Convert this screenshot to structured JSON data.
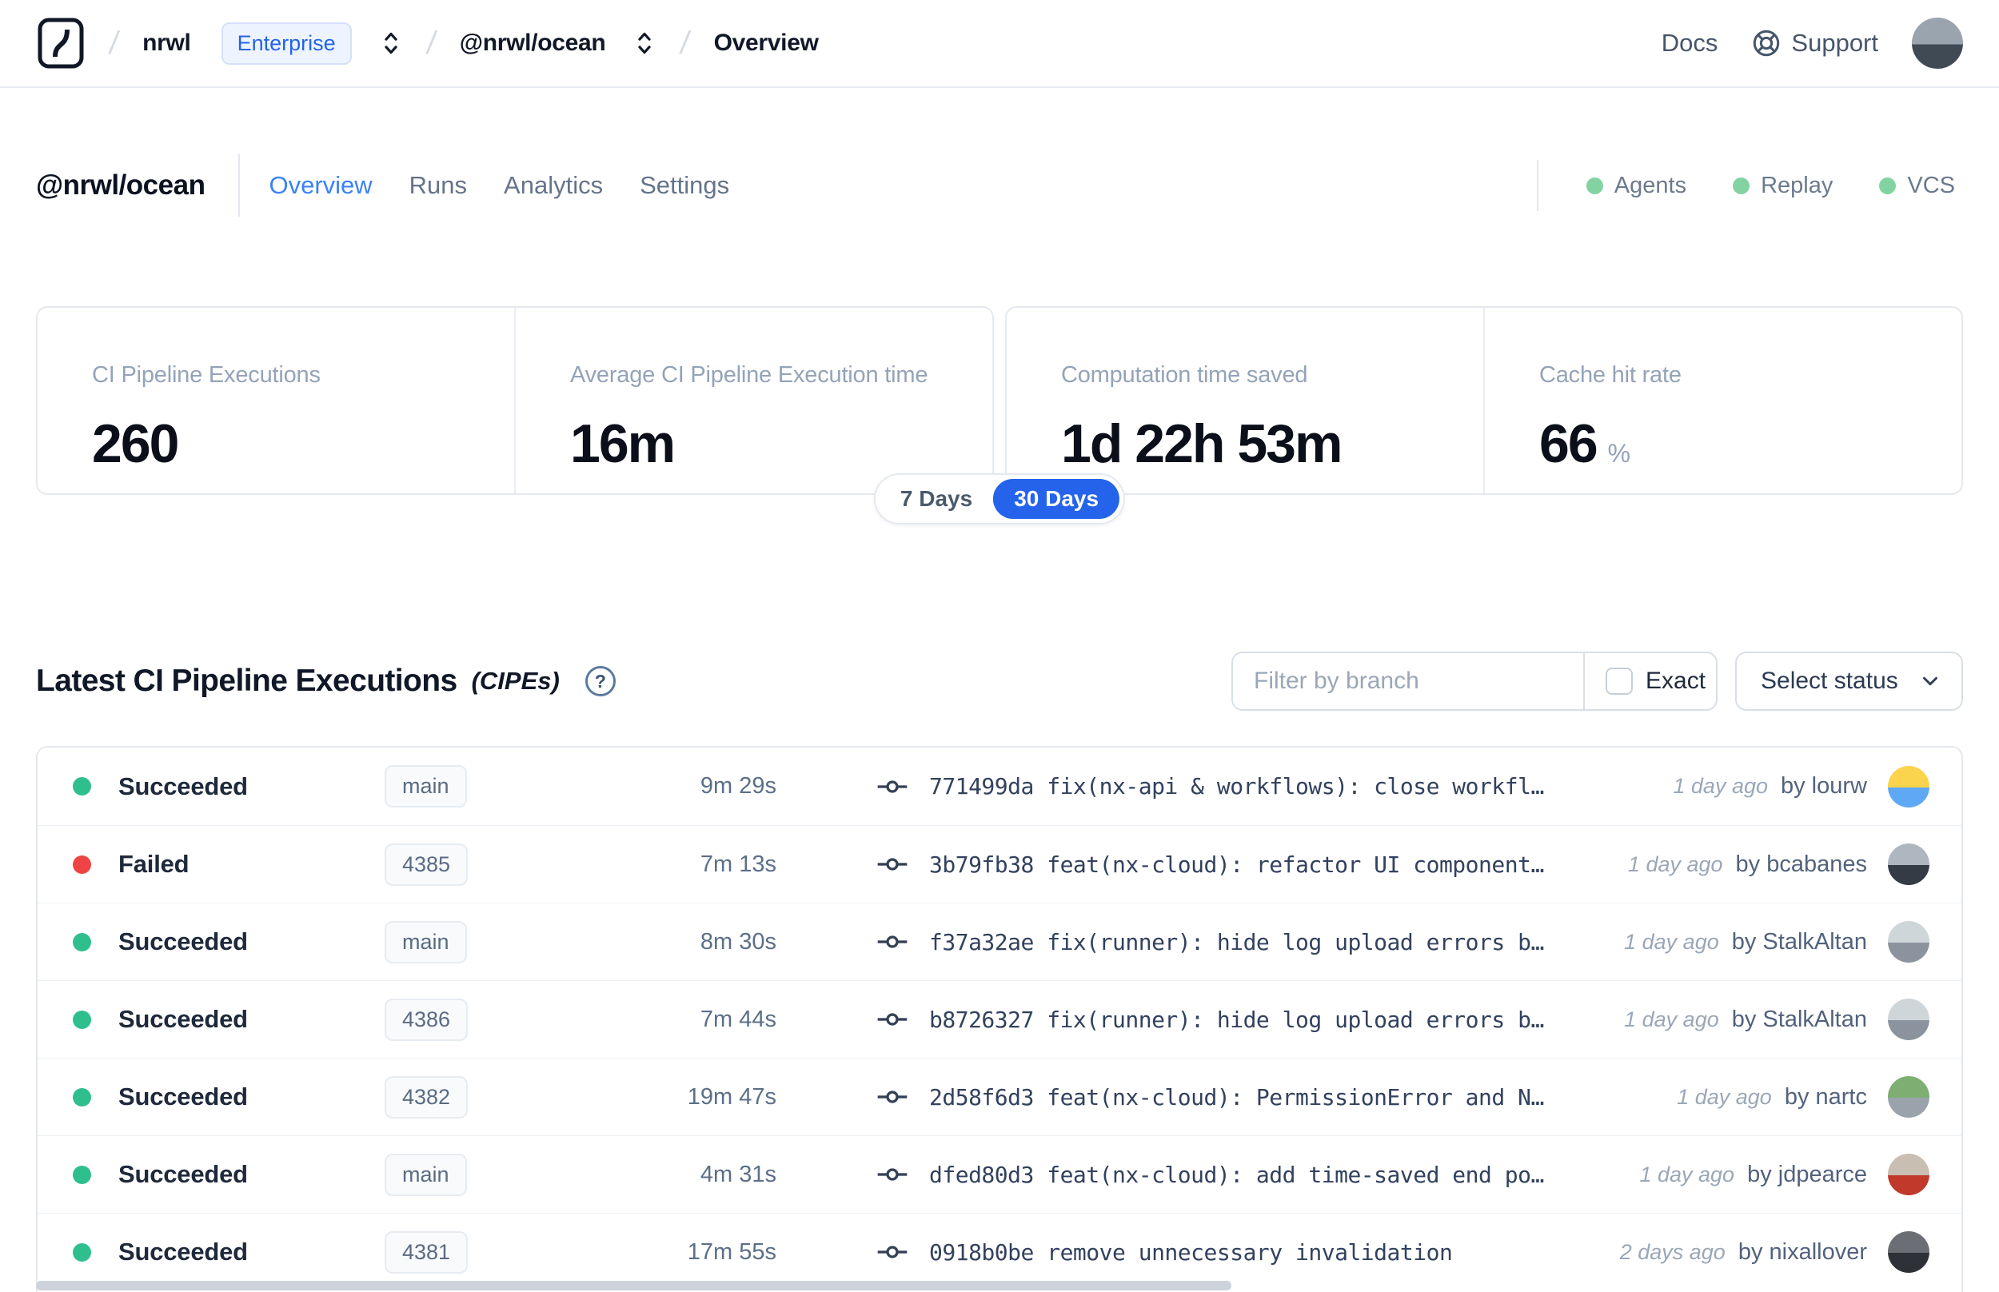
{
  "header": {
    "breadcrumb": {
      "org": "nrwl",
      "org_badge": "Enterprise",
      "workspace": "@nrwl/ocean",
      "page": "Overview"
    },
    "nav": {
      "docs": "Docs",
      "support": "Support"
    }
  },
  "workspace": {
    "title": "@nrwl/ocean",
    "tabs": [
      {
        "label": "Overview",
        "active": true
      },
      {
        "label": "Runs",
        "active": false
      },
      {
        "label": "Analytics",
        "active": false
      },
      {
        "label": "Settings",
        "active": false
      }
    ],
    "services": [
      {
        "label": "Agents"
      },
      {
        "label": "Replay"
      },
      {
        "label": "VCS"
      }
    ]
  },
  "stats": {
    "cards": [
      {
        "label": "CI Pipeline Executions",
        "value": "260",
        "suffix": ""
      },
      {
        "label": "Average CI Pipeline Execution time",
        "value": "16m",
        "suffix": ""
      },
      {
        "label": "Computation time saved",
        "value": "1d 22h 53m",
        "suffix": ""
      },
      {
        "label": "Cache hit rate",
        "value": "66",
        "suffix": "%"
      }
    ],
    "range_toggle": {
      "options": [
        "7 Days",
        "30 Days"
      ],
      "selected": "30 Days"
    }
  },
  "cipe_section": {
    "title": "Latest CI Pipeline Executions",
    "title_suffix": "(CIPEs)",
    "help_glyph": "?",
    "filter_placeholder": "Filter by branch",
    "exact_label": "Exact",
    "status_select_label": "Select status",
    "rows": [
      {
        "status": "Succeeded",
        "dot": "#2fbf8d",
        "branch": "main",
        "duration": "9m 29s",
        "commit": "771499da fix(nx-api & workflows): close workfl…",
        "time": "1 day ago",
        "author": "by lourw",
        "avatar": [
          "#fcd34d",
          "#5fa8f5"
        ]
      },
      {
        "status": "Failed",
        "dot": "#ef4444",
        "branch": "4385",
        "duration": "7m 13s",
        "commit": "3b79fb38 feat(nx-cloud): refactor UI component…",
        "time": "1 day ago",
        "author": "by bcabanes",
        "avatar": [
          "#aeb6c0",
          "#343b45"
        ]
      },
      {
        "status": "Succeeded",
        "dot": "#2fbf8d",
        "branch": "main",
        "duration": "8m 30s",
        "commit": "f37a32ae fix(runner): hide log upload errors b…",
        "time": "1 day ago",
        "author": "by StalkAltan",
        "avatar": [
          "#cfd6da",
          "#8b949e"
        ]
      },
      {
        "status": "Succeeded",
        "dot": "#2fbf8d",
        "branch": "4386",
        "duration": "7m 44s",
        "commit": "b8726327 fix(runner): hide log upload errors b…",
        "time": "1 day ago",
        "author": "by StalkAltan",
        "avatar": [
          "#cfd6da",
          "#8b949e"
        ]
      },
      {
        "status": "Succeeded",
        "dot": "#2fbf8d",
        "branch": "4382",
        "duration": "19m 47s",
        "commit": "2d58f6d3 feat(nx-cloud): PermissionError and N…",
        "time": "1 day ago",
        "author": "by nartc",
        "avatar": [
          "#7fae72",
          "#9aa3ab"
        ]
      },
      {
        "status": "Succeeded",
        "dot": "#2fbf8d",
        "branch": "main",
        "duration": "4m 31s",
        "commit": "dfed80d3 feat(nx-cloud): add time-saved end po…",
        "time": "1 day ago",
        "author": "by jdpearce",
        "avatar": [
          "#c9beb2",
          "#c0392b"
        ]
      },
      {
        "status": "Succeeded",
        "dot": "#2fbf8d",
        "branch": "4381",
        "duration": "17m 55s",
        "commit": "0918b0be remove unnecessary invalidation",
        "time": "2 days ago",
        "author": "by nixallover",
        "avatar": [
          "#6b6f75",
          "#2e3238"
        ]
      }
    ]
  },
  "colors": {
    "accent_blue": "#2563eb",
    "tab_active_blue": "#3b82f6",
    "service_dot_green": "#83d3a2",
    "succeeded_green": "#2fbf8d",
    "failed_red": "#ef4444",
    "user_avatar": [
      "#9aa4ae",
      "#3f4a55"
    ]
  }
}
